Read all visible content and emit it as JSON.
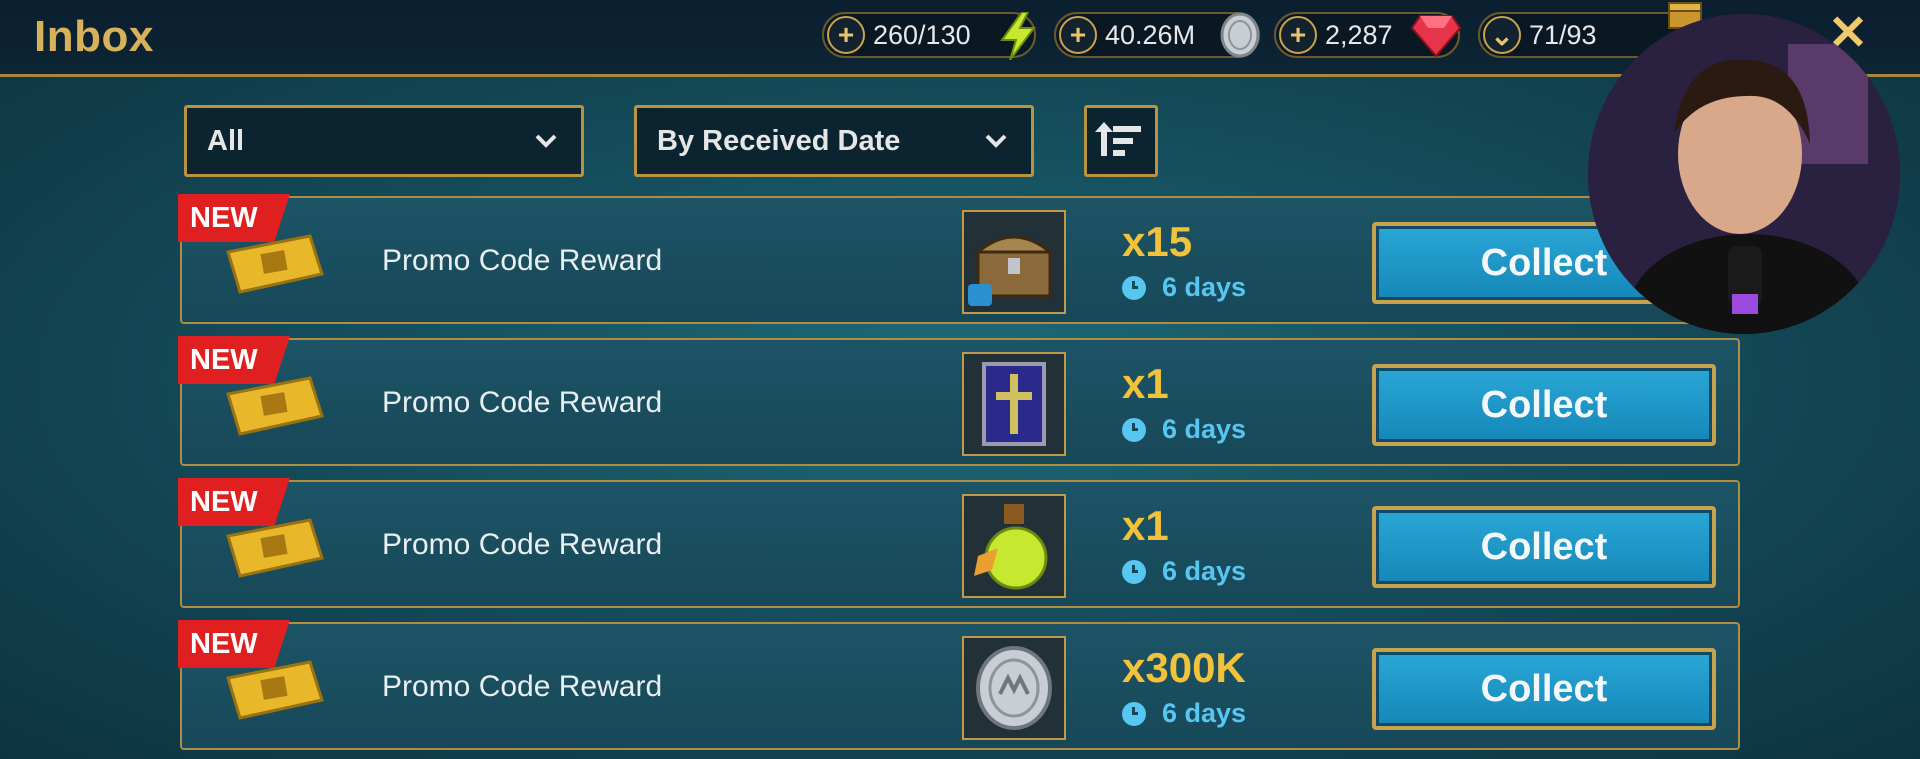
{
  "header": {
    "title": "Inbox"
  },
  "resources": [
    {
      "name": "energy",
      "value": "260/130",
      "button": "+",
      "icon": "lightning-icon"
    },
    {
      "name": "silver",
      "value": "40.26M",
      "button": "+",
      "icon": "silver-coin-icon"
    },
    {
      "name": "gems",
      "value": "2,287",
      "button": "+",
      "icon": "ruby-icon"
    },
    {
      "name": "arena-keys",
      "value": "71/93",
      "button": "⌄",
      "icon": "chest-icon"
    }
  ],
  "filters": {
    "category": "All",
    "sort": "By Received Date"
  },
  "rows": [
    {
      "tag": "NEW",
      "label": "Promo Code Reward",
      "item": "chest-icon",
      "qty": "x15",
      "time": "6 days",
      "button": "Collect"
    },
    {
      "tag": "NEW",
      "label": "Promo Code Reward",
      "item": "tome-icon",
      "qty": "x1",
      "time": "6 days",
      "button": "Collect"
    },
    {
      "tag": "NEW",
      "label": "Promo Code Reward",
      "item": "potion-icon",
      "qty": "x1",
      "time": "6 days",
      "button": "Collect"
    },
    {
      "tag": "NEW",
      "label": "Promo Code Reward",
      "item": "silver-coin-icon",
      "qty": "x300K",
      "time": "6 days",
      "button": "Collect"
    }
  ],
  "colors": {
    "accent_gold": "#d8b25a",
    "collect_blue": "#1e9ccd",
    "new_red": "#e02020",
    "timer_blue": "#57c6f0"
  }
}
